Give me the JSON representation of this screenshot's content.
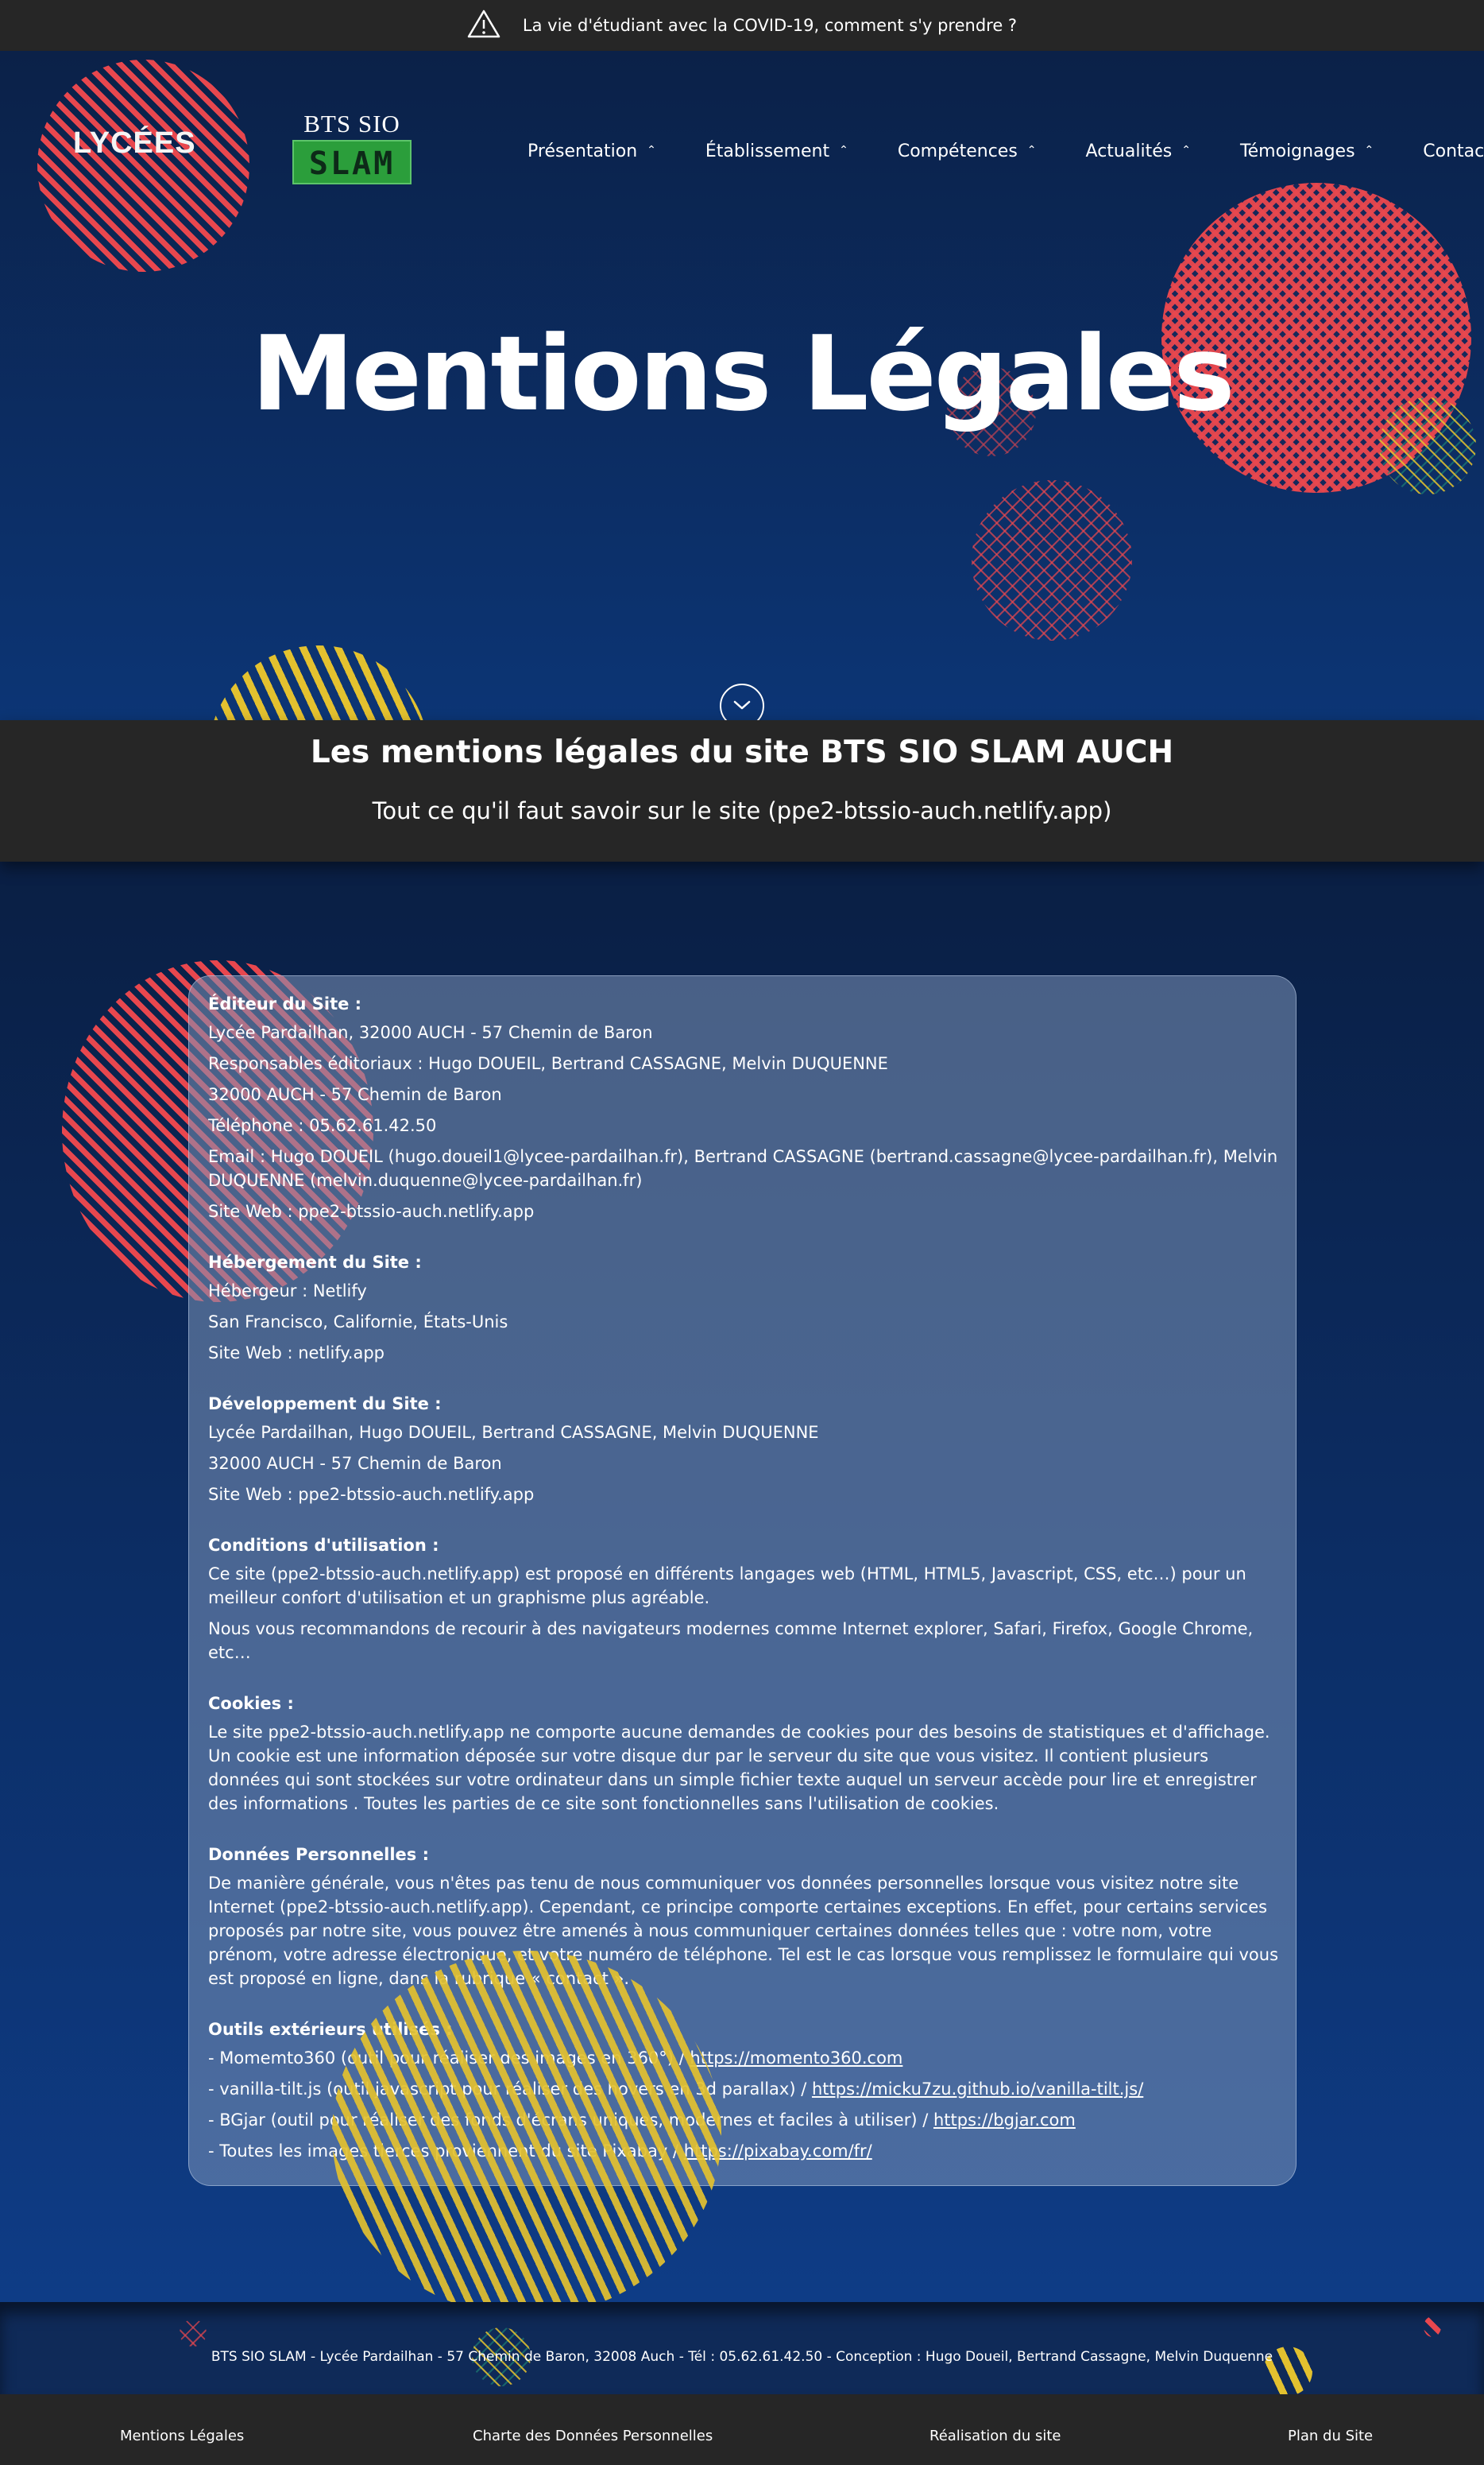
{
  "alert": {
    "text": "La vie d'étudiant avec la COVID-19, comment s'y prendre ?"
  },
  "brand": {
    "lycees_logo": "LYCÉES",
    "bts_top": "BTS SIO",
    "bts_bottom": "SLAM"
  },
  "nav": {
    "items": [
      {
        "label": "Présentation"
      },
      {
        "label": "Établissement"
      },
      {
        "label": "Compétences"
      },
      {
        "label": "Actualités"
      },
      {
        "label": "Témoignages"
      },
      {
        "label": "Contact"
      }
    ]
  },
  "hero": {
    "title": "Mentions Légales"
  },
  "band": {
    "title": "Les mentions légales du site BTS SIO SLAM AUCH",
    "subtitle": "Tout ce qu'il faut savoir sur le site (ppe2-btssio-auch.netlify.app)"
  },
  "content": {
    "editeur": {
      "heading": "Éditeur du Site :",
      "lines": [
        "Lycée Pardailhan, 32000 AUCH - 57 Chemin de Baron",
        "Responsables éditoriaux : Hugo DOUEIL, Bertrand CASSAGNE, Melvin DUQUENNE",
        "32000 AUCH - 57 Chemin de Baron",
        "Téléphone : 05.62.61.42.50",
        "Email : Hugo DOUEIL (hugo.doueil1@lycee-pardailhan.fr), Bertrand CASSAGNE (bertrand.cassagne@lycee-pardailhan.fr), Melvin DUQUENNE (melvin.duquenne@lycee-pardailhan.fr)",
        "Site Web : ppe2-btssio-auch.netlify.app"
      ]
    },
    "hebergement": {
      "heading": "Hébergement du Site :",
      "lines": [
        "Hébergeur : Netlify",
        "San Francisco, Californie, États-Unis",
        "Site Web : netlify.app"
      ]
    },
    "developpement": {
      "heading": "Développement du Site :",
      "lines": [
        "Lycée Pardailhan, Hugo DOUEIL, Bertrand CASSAGNE, Melvin DUQUENNE",
        "32000 AUCH - 57 Chemin de Baron",
        "Site Web : ppe2-btssio-auch.netlify.app"
      ]
    },
    "conditions": {
      "heading": "Conditions d'utilisation :",
      "lines": [
        "Ce site (ppe2-btssio-auch.netlify.app) est proposé en différents langages web (HTML, HTML5, Javascript, CSS, etc…) pour un meilleur confort d'utilisation et un graphisme plus agréable.",
        "Nous vous recommandons de recourir à des navigateurs modernes comme Internet explorer, Safari, Firefox, Google Chrome, etc…"
      ]
    },
    "cookies": {
      "heading": "Cookies :",
      "text": "Le site ppe2-btssio-auch.netlify.app ne comporte aucune demandes de cookies pour des besoins de statistiques et d'affichage. Un cookie est une information déposée sur votre disque dur par le serveur du site que vous visitez. Il contient plusieurs données qui sont stockées sur votre ordinateur dans un simple fichier texte auquel un serveur accède pour lire et enregistrer des informations . Toutes les parties de ce site sont fonctionnelles sans l'utilisation de cookies."
    },
    "donnees": {
      "heading": "Données Personnelles :",
      "text": "De manière générale, vous n'êtes pas tenu de nous communiquer vos données personnelles lorsque vous visitez notre site Internet (ppe2-btssio-auch.netlify.app). Cependant, ce principe comporte certaines exceptions. En effet, pour certains services proposés par notre site, vous pouvez être amenés à nous communiquer certaines données telles que : votre nom, votre prénom, votre adresse électronique, et votre numéro de téléphone. Tel est le cas lorsque vous remplissez le formulaire qui vous est proposé en ligne, dans la rubrique « contact »."
    },
    "outils": {
      "heading": "Outils extérieurs utilisés :",
      "items": [
        {
          "text": "- Momemto360 (outil pour réaliser des images en 360°) / ",
          "link": "https://momento360.com"
        },
        {
          "text": "- vanilla-tilt.js (outil javascript pour réaliser des hovers en 3d parallax) / ",
          "link": "https://micku7zu.github.io/vanilla-tilt.js/"
        },
        {
          "text": "- BGjar (outil pour réaliser des fonds d'écrans uniques, modernes et faciles à utiliser) / ",
          "link": "https://bgjar.com"
        },
        {
          "text": "- Toutes les images tierces proviennent du site Pixabay / ",
          "link": "https://pixabay.com/fr/"
        }
      ]
    }
  },
  "footer": {
    "info": "BTS SIO SLAM - Lycée Pardailhan - 57 Chemin de Baron, 32008 Auch - Tél : 05.62.61.42.50 - Conception : Hugo Doueil, Bertrand Cassagne, Melvin Duquenne",
    "links": [
      {
        "label": "Mentions Légales"
      },
      {
        "label": "Charte des Données Personnelles"
      },
      {
        "label": "Réalisation du site"
      },
      {
        "label": "Plan du Site"
      }
    ]
  },
  "colors": {
    "accent_red": "#e8474e",
    "accent_yellow": "#e3c12f",
    "dark_bar": "#262626",
    "hero_blue": "#0c3575"
  },
  "icons": {
    "alert": "warning-icon",
    "scroll": "chevron-down-icon",
    "nav_chevron": "chevron-up-icon"
  }
}
